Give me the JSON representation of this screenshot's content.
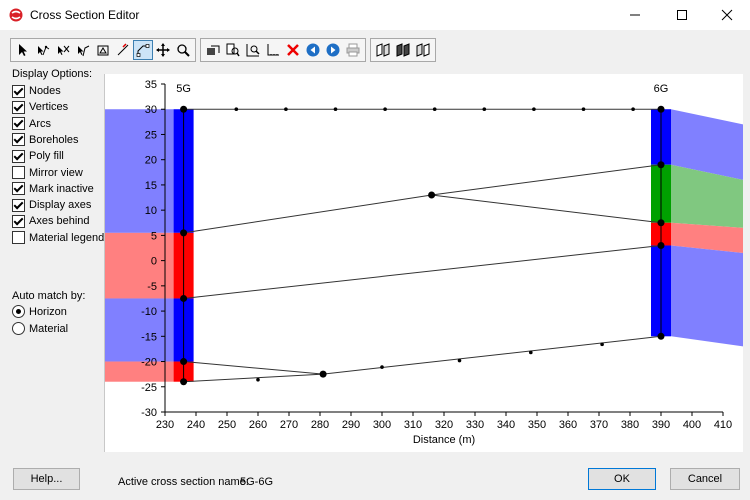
{
  "window": {
    "title": "Cross Section Editor"
  },
  "display_options": {
    "title": "Display Options:",
    "items": [
      {
        "label": "Nodes",
        "checked": true
      },
      {
        "label": "Vertices",
        "checked": true
      },
      {
        "label": "Arcs",
        "checked": true
      },
      {
        "label": "Boreholes",
        "checked": true
      },
      {
        "label": "Poly fill",
        "checked": true
      },
      {
        "label": "Mirror view",
        "checked": false
      },
      {
        "label": "Mark inactive",
        "checked": true
      },
      {
        "label": "Display axes",
        "checked": true
      },
      {
        "label": "Axes behind",
        "checked": true
      },
      {
        "label": "Material legend",
        "checked": false
      }
    ]
  },
  "auto_match": {
    "title": "Auto match by:",
    "options": [
      {
        "label": "Horizon",
        "selected": true
      },
      {
        "label": "Material",
        "selected": false
      }
    ]
  },
  "chart_data": {
    "type": "cross-section",
    "xlabel": "Distance (m)",
    "xlim": [
      230,
      410
    ],
    "ylim": [
      -30,
      35
    ],
    "x_ticks": [
      230,
      240,
      250,
      260,
      270,
      280,
      290,
      300,
      310,
      320,
      330,
      340,
      350,
      360,
      370,
      380,
      390,
      400,
      410
    ],
    "y_ticks": [
      35,
      30,
      25,
      20,
      15,
      10,
      5,
      0,
      -5,
      -10,
      -15,
      -20,
      -25,
      -30
    ],
    "boreholes": [
      {
        "name": "5G",
        "x": 236
      },
      {
        "name": "6G",
        "x": 390
      }
    ],
    "colors": {
      "blue": "#8080ff",
      "red": "#ff8080",
      "green": "#80c880",
      "borehole_blue": "#0000ff",
      "borehole_red": "#ff0000",
      "borehole_green": "#00a000"
    },
    "horizons": [
      {
        "points": [
          [
            236,
            30
          ],
          [
            390,
            30
          ]
        ]
      },
      {
        "points": [
          [
            236,
            5.5
          ],
          [
            316,
            13
          ],
          [
            390,
            19
          ]
        ]
      },
      {
        "points": [
          [
            316,
            13
          ],
          [
            390,
            7.5
          ]
        ]
      },
      {
        "points": [
          [
            236,
            -7.5
          ],
          [
            390,
            3
          ]
        ]
      },
      {
        "points": [
          [
            236,
            -20
          ],
          [
            281,
            -22.5
          ],
          [
            390,
            -15
          ]
        ]
      },
      {
        "points": [
          [
            236,
            -24
          ],
          [
            281,
            -22.5
          ]
        ]
      }
    ],
    "vertices": [
      [
        253,
        30
      ],
      [
        269,
        30
      ],
      [
        285,
        30
      ],
      [
        301,
        30
      ],
      [
        317,
        30
      ],
      [
        333,
        30
      ],
      [
        349,
        30
      ],
      [
        365,
        30
      ],
      [
        381,
        30
      ],
      [
        260,
        -23.6
      ],
      [
        300,
        -21.1
      ],
      [
        325,
        -19.8
      ],
      [
        348,
        -18.2
      ],
      [
        371,
        -16.6
      ]
    ],
    "nodes": [
      [
        236,
        30
      ],
      [
        236,
        5.5
      ],
      [
        236,
        -7.5
      ],
      [
        236,
        -20
      ],
      [
        236,
        -24
      ],
      [
        390,
        30
      ],
      [
        390,
        19
      ],
      [
        390,
        7.5
      ],
      [
        390,
        3
      ],
      [
        390,
        -15
      ],
      [
        316,
        13
      ],
      [
        281,
        -22.5
      ]
    ],
    "units": {
      "left": [
        {
          "color": "blue",
          "top": 30,
          "bottom": 5.5
        },
        {
          "color": "red",
          "top": 5.5,
          "bottom": -7.5
        },
        {
          "color": "blue",
          "top": -7.5,
          "bottom": -20
        },
        {
          "color": "red",
          "top": -20,
          "bottom": -24
        }
      ],
      "right": [
        {
          "color": "blue",
          "top": 30,
          "bottom": 19
        },
        {
          "color": "green",
          "top": 19,
          "bottom": 7.5
        },
        {
          "color": "red",
          "top": 7.5,
          "bottom": 3
        },
        {
          "color": "blue",
          "top": 3,
          "bottom": -15
        }
      ]
    }
  },
  "footer": {
    "help_label": "Help...",
    "active_label": "Active cross section name:",
    "active_value": "5G-6G",
    "ok_label": "OK",
    "cancel_label": "Cancel"
  }
}
